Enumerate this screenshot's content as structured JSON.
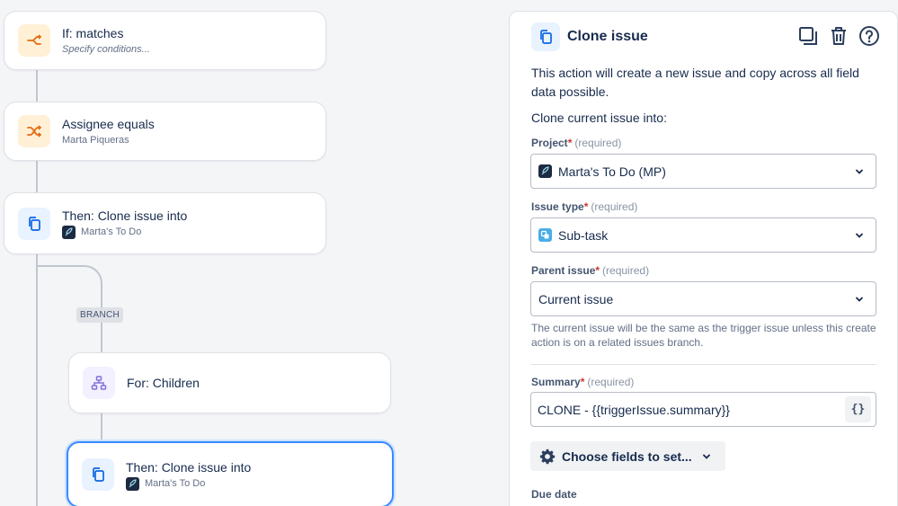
{
  "flow": {
    "nodes": [
      {
        "title": "If: matches",
        "subtitle": "Specify conditions..."
      },
      {
        "title": "Assignee equals",
        "subtitle": "Marta Piqueras"
      },
      {
        "title": "Then: Clone issue into",
        "subtitle": "Marta's To Do"
      },
      {
        "title": "For: Children"
      },
      {
        "title": "Then: Clone issue into",
        "subtitle": "Marta's To Do"
      }
    ],
    "branch_label": "BRANCH"
  },
  "panel": {
    "title": "Clone issue",
    "description": "This action will create a new issue and copy across all field data possible.",
    "clone_into_label": "Clone current issue into:",
    "required_text": "(required)",
    "fields": {
      "project": {
        "label": "Project",
        "value": "Marta's To Do (MP)"
      },
      "issue_type": {
        "label": "Issue type",
        "value": "Sub-task"
      },
      "parent_issue": {
        "label": "Parent issue",
        "value": "Current issue",
        "help": "The current issue will be the same as the trigger issue unless this create action is on a related issues branch."
      },
      "summary": {
        "label": "Summary",
        "value": "CLONE - {{triggerIssue.summary}}",
        "smart_values_label": "{}"
      },
      "due_date": {
        "label": "Due date"
      }
    },
    "choose_fields_label": "Choose fields to set...",
    "icons": [
      "copy-icon",
      "duplicate-icon",
      "trash-icon",
      "help-icon",
      "chevron-down-icon",
      "gear-icon",
      "rocket-icon",
      "subtask-icon",
      "hierarchy-icon",
      "shuffle-icon",
      "branch-icon"
    ]
  },
  "colors": {
    "accent": "#0c66e4",
    "selected_border": "#388bff",
    "required_star": "#c9372c",
    "orange_icon": "#e56910",
    "purple_icon": "#8270db"
  }
}
